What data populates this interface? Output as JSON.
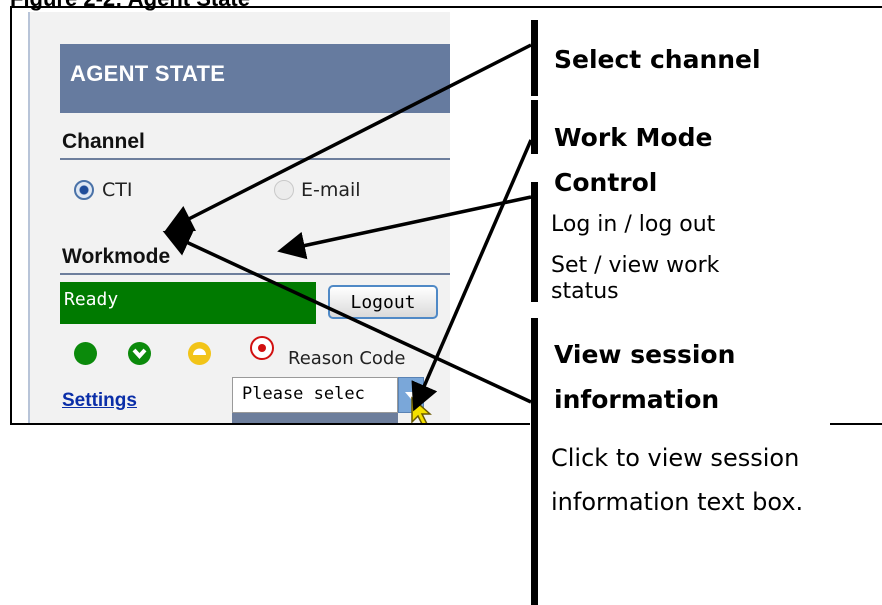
{
  "figure_title": "Figure 2-2:  Agent State",
  "panel": {
    "header_title": "AGENT STATE",
    "channel_label": "Channel",
    "channel_options": [
      {
        "label": "CTI",
        "selected": true
      },
      {
        "label": "E-mail",
        "selected": false
      }
    ],
    "workmode_label": "Workmode",
    "status_value": "Ready",
    "status_color": "#007a00",
    "logout_label": "Logout",
    "state_icons": [
      "green-dot-icon",
      "green-check-icon",
      "yellow-half-icon",
      "red-stop-icon"
    ],
    "reason_code_label": "Reason Code",
    "settings_link": "Settings",
    "reason_select_value": "Please selec",
    "header_color": "#667b9f",
    "link_color": "#0a2ea8"
  },
  "annotations": {
    "select_channel": "Select channel",
    "work_mode_line1": "Work Mode",
    "work_mode_line2": "Control",
    "login_logout": "Log in / log out",
    "set_view_work_status": "Set / view work status",
    "view_session_line1": "View session",
    "view_session_line2": "information",
    "click_to_view": "Click to view session information text box."
  }
}
